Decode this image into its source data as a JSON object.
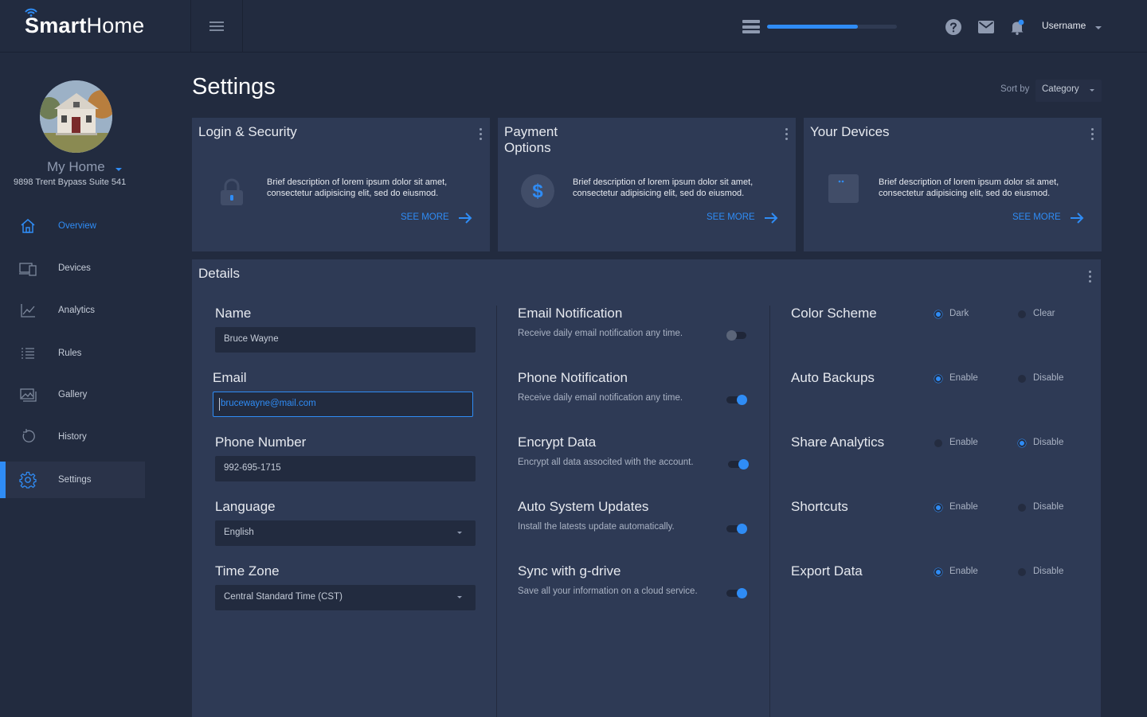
{
  "brand": {
    "name_bold": "Sm",
    "name_bold2": "art",
    "name_light": "Home"
  },
  "topbar": {
    "progress_percent": 70,
    "username": "Username"
  },
  "sidebar": {
    "home_name": "My Home",
    "home_address": "9898 Trent Bypass Suite 541",
    "items": [
      {
        "label": "Overview",
        "icon": "home-icon"
      },
      {
        "label": "Devices",
        "icon": "devices-icon"
      },
      {
        "label": "Analytics",
        "icon": "analytics-icon"
      },
      {
        "label": "Rules",
        "icon": "rules-icon"
      },
      {
        "label": "Gallery",
        "icon": "gallery-icon"
      },
      {
        "label": "History",
        "icon": "history-icon"
      },
      {
        "label": "Settings",
        "icon": "gear-icon"
      }
    ],
    "active": "Settings"
  },
  "page": {
    "title": "Settings",
    "sort_label": "Sort by",
    "sort_value": "Category"
  },
  "cards": [
    {
      "title": "Login & Security",
      "desc": "Brief description of lorem ipsum dolor sit amet, consectetur adipisicing elit, sed do eiusmod.",
      "link": "SEE MORE",
      "icon": "lock-icon"
    },
    {
      "title": "Payment Options",
      "desc": "Brief description of lorem ipsum dolor sit amet, consectetur adipisicing elit, sed do eiusmod.",
      "link": "SEE MORE",
      "icon": "dollar-icon"
    },
    {
      "title": "Your Devices",
      "desc": "Brief description of lorem ipsum dolor sit amet, consectetur adipisicing elit, sed do eiusmod.",
      "link": "SEE MORE",
      "icon": "device-icon"
    }
  ],
  "details": {
    "title": "Details",
    "fields": {
      "name": {
        "label": "Name",
        "value": "Bruce Wayne"
      },
      "email": {
        "label": "Email",
        "value": "brucewayne@mail.com"
      },
      "phone": {
        "label": "Phone Number",
        "value": "992-695-1715"
      },
      "language": {
        "label": "Language",
        "value": "English"
      },
      "timezone": {
        "label": "Time Zone",
        "value": "Central Standard Time (CST)"
      }
    },
    "toggles": [
      {
        "title": "Email Notification",
        "desc": "Receive daily email notification any time.",
        "on": false
      },
      {
        "title": "Phone Notification",
        "desc": "Receive daily email notification any time.",
        "on": true
      },
      {
        "title": "Encrypt Data",
        "desc": "Encrypt all data associted with the account.",
        "on": true
      },
      {
        "title": "Auto System Updates",
        "desc": "Install the latests update automatically.",
        "on": true
      },
      {
        "title": "Sync with g-drive",
        "desc": "Save all your information on a cloud service.",
        "on": true
      }
    ],
    "options": [
      {
        "title": "Color Scheme",
        "a": "Dark",
        "b": "Clear",
        "selected": "a"
      },
      {
        "title": "Auto Backups",
        "a": "Enable",
        "b": "Disable",
        "selected": "a"
      },
      {
        "title": "Share Analytics",
        "a": "Enable",
        "b": "Disable",
        "selected": "b"
      },
      {
        "title": "Shortcuts",
        "a": "Enable",
        "b": "Disable",
        "selected": "a"
      },
      {
        "title": "Export Data",
        "a": "Enable",
        "b": "Disable",
        "selected": "a"
      }
    ]
  },
  "colors": {
    "accent": "#2f8cf5",
    "background": "#222b3f",
    "panel": "#2e3a55"
  }
}
